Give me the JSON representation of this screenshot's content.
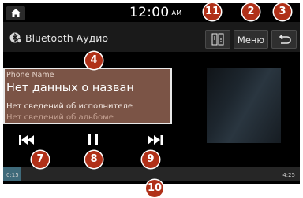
{
  "status_bar": {
    "time": "12:00",
    "ampm": "AM"
  },
  "title_bar": {
    "source_title": "Bluetooth Аудио",
    "menu_label": "Меню"
  },
  "track_info": {
    "phone_name": "Phone Name",
    "title": "Нет данных о назван",
    "artist": "Нет сведений об исполнителе",
    "album": "Нет сведений об альбоме"
  },
  "progress": {
    "elapsed": "0:15",
    "total": "4:25",
    "fraction": 0.06
  },
  "callouts": [
    "11",
    "2",
    "3",
    "4",
    "7",
    "8",
    "9",
    "10"
  ],
  "colors": {
    "accent": "#b03018",
    "info_bg": "#7b5446",
    "progress_fill": "#3f6a7a"
  },
  "icons": [
    "home-icon",
    "bluetooth-icon",
    "list-icon",
    "back-icon",
    "previous-track-icon",
    "pause-icon",
    "next-track-icon"
  ]
}
